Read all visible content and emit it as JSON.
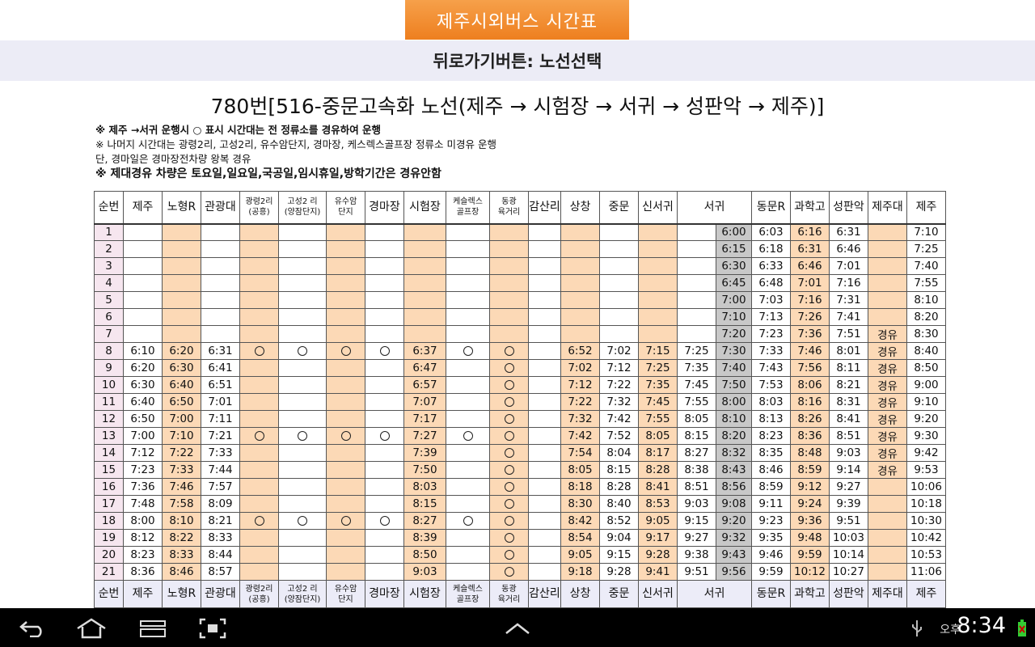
{
  "header": {
    "title": "제주시외버스 시간표",
    "back_bar": "뒤로가기버튼: 노선선택"
  },
  "route_title": "780번[516-중문고속화 노선(제주 → 시험장 → 서귀 → 성판악 → 제주)]",
  "notes": [
    "※ 제주 →서귀 운행시 ○ 표시 시간대는 전 정류소를 경유하여 운행",
    "※ 나머지 시간대는 광령2리, 고성2리, 유수암단지, 경마장, 케스렉스골프장 정류소 미경유 운행",
    "단, 경마일은 경마장전차량 왕복 경유",
    "※ 제대경유 차량은 토요일,일요일,국공일,임시휴일,방학기간은 경유안함"
  ],
  "columns": [
    "순번",
    "제주",
    "노형R",
    "관광대",
    "광령2리\n(공흥)",
    "고성2 리\n(양잠단지)",
    "유수암\n단지",
    "경마장",
    "시험장",
    "케슬렉스\n골프장",
    "동광\n육거리",
    "감산리",
    "상창",
    "중문",
    "신서귀",
    "서귀",
    "동문R",
    "과학고",
    "성판악",
    "제주대",
    "제주"
  ],
  "rows": [
    [
      "1",
      "",
      "",
      "",
      "",
      "",
      "",
      "",
      "",
      "",
      "",
      "",
      "",
      "",
      "",
      "",
      "6:00",
      "6:03",
      "6:16",
      "6:31",
      "",
      "7:10"
    ],
    [
      "2",
      "",
      "",
      "",
      "",
      "",
      "",
      "",
      "",
      "",
      "",
      "",
      "",
      "",
      "",
      "",
      "6:15",
      "6:18",
      "6:31",
      "6:46",
      "",
      "7:25"
    ],
    [
      "3",
      "",
      "",
      "",
      "",
      "",
      "",
      "",
      "",
      "",
      "",
      "",
      "",
      "",
      "",
      "",
      "6:30",
      "6:33",
      "6:46",
      "7:01",
      "",
      "7:40"
    ],
    [
      "4",
      "",
      "",
      "",
      "",
      "",
      "",
      "",
      "",
      "",
      "",
      "",
      "",
      "",
      "",
      "",
      "6:45",
      "6:48",
      "7:01",
      "7:16",
      "",
      "7:55"
    ],
    [
      "5",
      "",
      "",
      "",
      "",
      "",
      "",
      "",
      "",
      "",
      "",
      "",
      "",
      "",
      "",
      "",
      "7:00",
      "7:03",
      "7:16",
      "7:31",
      "",
      "8:10"
    ],
    [
      "6",
      "",
      "",
      "",
      "",
      "",
      "",
      "",
      "",
      "",
      "",
      "",
      "",
      "",
      "",
      "",
      "7:10",
      "7:13",
      "7:26",
      "7:41",
      "",
      "8:20"
    ],
    [
      "7",
      "",
      "",
      "",
      "",
      "",
      "",
      "",
      "",
      "",
      "",
      "",
      "",
      "",
      "",
      "",
      "7:20",
      "7:23",
      "7:36",
      "7:51",
      "경유",
      "8:30"
    ],
    [
      "8",
      "6:10",
      "6:20",
      "6:31",
      "○",
      "○",
      "○",
      "○",
      "6:37",
      "○",
      "○",
      "",
      "6:52",
      "7:02",
      "7:15",
      "7:25",
      "7:30",
      "7:33",
      "7:46",
      "8:01",
      "경유",
      "8:40"
    ],
    [
      "9",
      "6:20",
      "6:30",
      "6:41",
      "",
      "",
      "",
      "",
      "6:47",
      "",
      "○",
      "",
      "7:02",
      "7:12",
      "7:25",
      "7:35",
      "7:40",
      "7:43",
      "7:56",
      "8:11",
      "경유",
      "8:50"
    ],
    [
      "10",
      "6:30",
      "6:40",
      "6:51",
      "",
      "",
      "",
      "",
      "6:57",
      "",
      "○",
      "",
      "7:12",
      "7:22",
      "7:35",
      "7:45",
      "7:50",
      "7:53",
      "8:06",
      "8:21",
      "경유",
      "9:00"
    ],
    [
      "11",
      "6:40",
      "6:50",
      "7:01",
      "",
      "",
      "",
      "",
      "7:07",
      "",
      "○",
      "",
      "7:22",
      "7:32",
      "7:45",
      "7:55",
      "8:00",
      "8:03",
      "8:16",
      "8:31",
      "경유",
      "9:10"
    ],
    [
      "12",
      "6:50",
      "7:00",
      "7:11",
      "",
      "",
      "",
      "",
      "7:17",
      "",
      "○",
      "",
      "7:32",
      "7:42",
      "7:55",
      "8:05",
      "8:10",
      "8:13",
      "8:26",
      "8:41",
      "경유",
      "9:20"
    ],
    [
      "13",
      "7:00",
      "7:10",
      "7:21",
      "○",
      "○",
      "○",
      "○",
      "7:27",
      "○",
      "○",
      "",
      "7:42",
      "7:52",
      "8:05",
      "8:15",
      "8:20",
      "8:23",
      "8:36",
      "8:51",
      "경유",
      "9:30"
    ],
    [
      "14",
      "7:12",
      "7:22",
      "7:33",
      "",
      "",
      "",
      "",
      "7:39",
      "",
      "○",
      "",
      "7:54",
      "8:04",
      "8:17",
      "8:27",
      "8:32",
      "8:35",
      "8:48",
      "9:03",
      "경유",
      "9:42"
    ],
    [
      "15",
      "7:23",
      "7:33",
      "7:44",
      "",
      "",
      "",
      "",
      "7:50",
      "",
      "○",
      "",
      "8:05",
      "8:15",
      "8:28",
      "8:38",
      "8:43",
      "8:46",
      "8:59",
      "9:14",
      "경유",
      "9:53"
    ],
    [
      "16",
      "7:36",
      "7:46",
      "7:57",
      "",
      "",
      "",
      "",
      "8:03",
      "",
      "○",
      "",
      "8:18",
      "8:28",
      "8:41",
      "8:51",
      "8:56",
      "8:59",
      "9:12",
      "9:27",
      "",
      "10:06"
    ],
    [
      "17",
      "7:48",
      "7:58",
      "8:09",
      "",
      "",
      "",
      "",
      "8:15",
      "",
      "○",
      "",
      "8:30",
      "8:40",
      "8:53",
      "9:03",
      "9:08",
      "9:11",
      "9:24",
      "9:39",
      "",
      "10:18"
    ],
    [
      "18",
      "8:00",
      "8:10",
      "8:21",
      "○",
      "○",
      "○",
      "○",
      "8:27",
      "○",
      "○",
      "",
      "8:42",
      "8:52",
      "9:05",
      "9:15",
      "9:20",
      "9:23",
      "9:36",
      "9:51",
      "",
      "10:30"
    ],
    [
      "19",
      "8:12",
      "8:22",
      "8:33",
      "",
      "",
      "",
      "",
      "8:39",
      "",
      "○",
      "",
      "8:54",
      "9:04",
      "9:17",
      "9:27",
      "9:32",
      "9:35",
      "9:48",
      "10:03",
      "",
      "10:42"
    ],
    [
      "20",
      "8:23",
      "8:33",
      "8:44",
      "",
      "",
      "",
      "",
      "8:50",
      "",
      "○",
      "",
      "9:05",
      "9:15",
      "9:28",
      "9:38",
      "9:43",
      "9:46",
      "9:59",
      "10:14",
      "",
      "10:53"
    ],
    [
      "21",
      "8:36",
      "8:46",
      "8:57",
      "",
      "",
      "",
      "",
      "9:03",
      "",
      "○",
      "",
      "9:18",
      "9:28",
      "9:41",
      "9:51",
      "9:56",
      "9:59",
      "10:12",
      "10:27",
      "",
      "11:06"
    ]
  ],
  "status_bar": {
    "ampm": "오후",
    "time": "8:34"
  },
  "colors": {
    "orange_col": "#fcd9b6",
    "gray_col": "#c8c8c8",
    "title_orange": "#ee7f1f"
  }
}
